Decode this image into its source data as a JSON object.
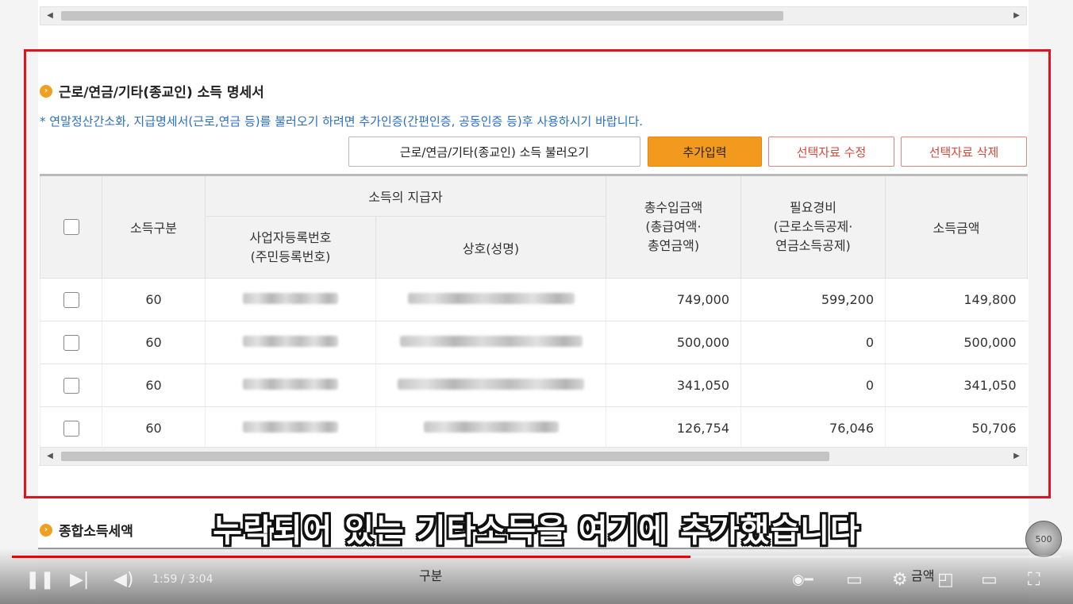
{
  "section_title": "근로/연금/기타(종교인) 소득 명세서",
  "notice": "* 연말정산간소화, 지급명세서(근로,연금 등)를 불러오기 하려면 추가인증(간편인증, 공동인증 등)후 사용하시기 바랍니다.",
  "buttons": {
    "load": "근로/연금/기타(종교인) 소득 불러오기",
    "add": "추가입력",
    "edit": "선택자료 수정",
    "delete": "선택자료 삭제"
  },
  "table": {
    "headers": {
      "income_type": "소득구분",
      "payer": "소득의 지급자",
      "biz_no": "사업자등록번호\n(주민등록번호)",
      "name": "상호(성명)",
      "total": "총수입금액\n(총급여액·\n총연금액)",
      "expense": "필요경비\n(근로소득공제·\n연금소득공제)",
      "income": "소득금액"
    },
    "rows": [
      {
        "type": "60",
        "total": "749,000",
        "expense": "599,200",
        "income": "149,800"
      },
      {
        "type": "60",
        "total": "500,000",
        "expense": "0",
        "income": "500,000"
      },
      {
        "type": "60",
        "total": "341,050",
        "expense": "0",
        "income": "341,050"
      },
      {
        "type": "60",
        "total": "126,754",
        "expense": "76,046",
        "income": "50,706"
      }
    ]
  },
  "section2_title": "종합소득세액",
  "section2_headers": {
    "col1": "구분",
    "col2": "금액"
  },
  "subtitle": "누락되어 있는 기타소득을 여기에 추가했습니다",
  "player": {
    "time": "1:59 / 3:04",
    "progress": 0.647,
    "coin_label": "500"
  },
  "icons": [
    "bullet-icon",
    "pause-icon",
    "next-icon",
    "volume-icon",
    "autoplay-toggle-icon",
    "captions-icon",
    "settings-icon",
    "miniplayer-icon",
    "theater-icon",
    "fullscreen-icon"
  ]
}
